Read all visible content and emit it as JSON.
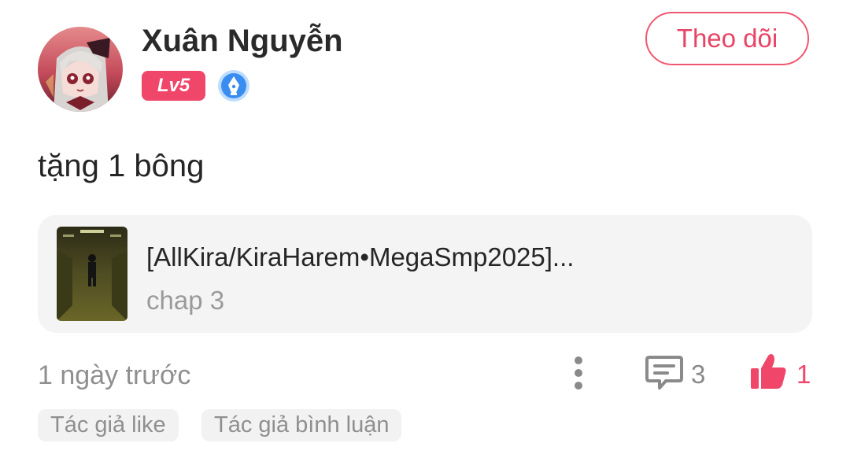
{
  "comment": {
    "username": "Xuân Nguyễn",
    "level_badge": "Lv5",
    "follow_label": "Theo dõi",
    "text": "tặng 1 bông",
    "story": {
      "title": "[AllKira/KiraHarem•MegaSmp2025]...",
      "chapter": "chap 3"
    },
    "timestamp": "1 ngày trước",
    "comment_count": "3",
    "like_count": "1",
    "tags": [
      "Tác giả like",
      "Tác giả bình luận"
    ]
  },
  "icons": {
    "writer_badge": "pen-nib-icon",
    "more": "more-vertical-icon",
    "comment": "comment-icon",
    "like": "thumbs-up-icon"
  },
  "colors": {
    "accent": "#f0466a",
    "follow_border": "#f0566f",
    "card_background": "#f4f4f4",
    "muted_text": "#8f8f8f",
    "writer_badge": "#3a8df0"
  }
}
